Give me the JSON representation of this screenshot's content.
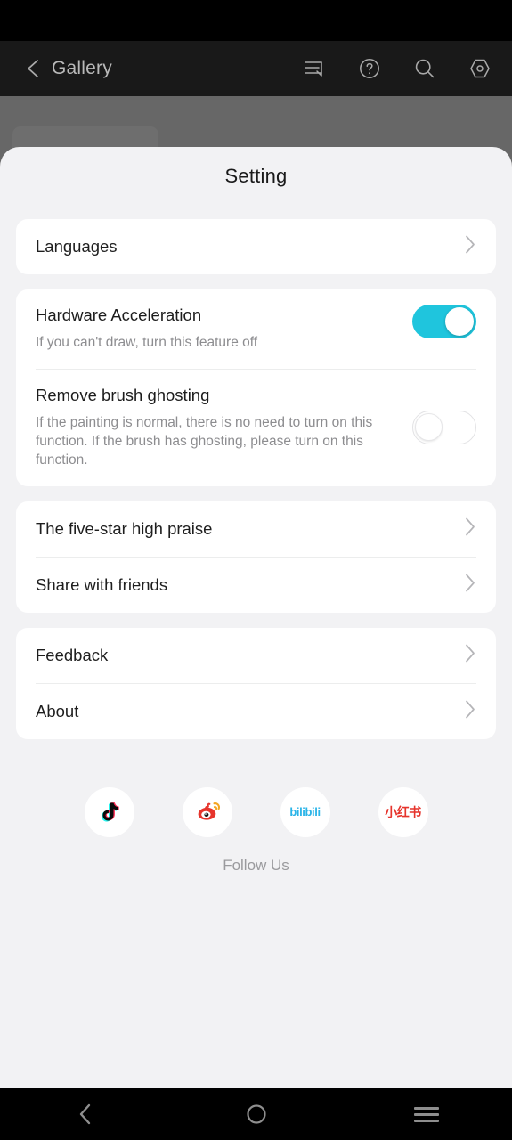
{
  "app_header": {
    "back_icon": "chevron-left-icon",
    "title": "Gallery",
    "icons": [
      "layers-icon",
      "help-circle-icon",
      "search-icon",
      "hexagon-record-icon"
    ]
  },
  "sheet": {
    "title": "Setting",
    "groups": [
      {
        "id": "languages",
        "rows": [
          {
            "label": "Languages",
            "type": "link",
            "chevron": "chevron-right-icon"
          }
        ]
      },
      {
        "id": "rendering",
        "rows": [
          {
            "label": "Hardware Acceleration",
            "description": "If you can't draw, turn this feature off",
            "type": "toggle",
            "value": true
          },
          {
            "label": "Remove brush ghosting",
            "description": "If the painting is normal, there is no need to turn on this function. If the brush has ghosting, please turn on this function.",
            "type": "toggle",
            "value": false
          }
        ]
      },
      {
        "id": "promote",
        "rows": [
          {
            "label": "The five-star high praise",
            "type": "link",
            "chevron": "chevron-right-icon"
          },
          {
            "label": "Share with friends",
            "type": "link",
            "chevron": "chevron-right-icon"
          }
        ]
      },
      {
        "id": "info",
        "rows": [
          {
            "label": "Feedback",
            "type": "link",
            "chevron": "chevron-right-icon"
          },
          {
            "label": "About",
            "type": "link",
            "chevron": "chevron-right-icon"
          }
        ]
      }
    ],
    "social": {
      "items": [
        {
          "name": "tiktok-icon",
          "label": "TikTok"
        },
        {
          "name": "weibo-icon",
          "label": "Weibo"
        },
        {
          "name": "bilibili-icon",
          "label": "bilibili"
        },
        {
          "name": "xiaohongshu-icon",
          "label": "小红书"
        }
      ],
      "caption": "Follow Us"
    }
  },
  "navbar": {
    "back": "nav-back-icon",
    "home": "nav-home-icon",
    "recents": "nav-recents-icon"
  },
  "colors": {
    "toggle_on": "#1fc5dd",
    "sheet_bg": "#f2f2f4",
    "card_bg": "#ffffff",
    "backdrop": "#676767",
    "header_bg": "#191919",
    "weibo_red": "#e6342c",
    "bilibili_blue": "#2ab4e8"
  }
}
